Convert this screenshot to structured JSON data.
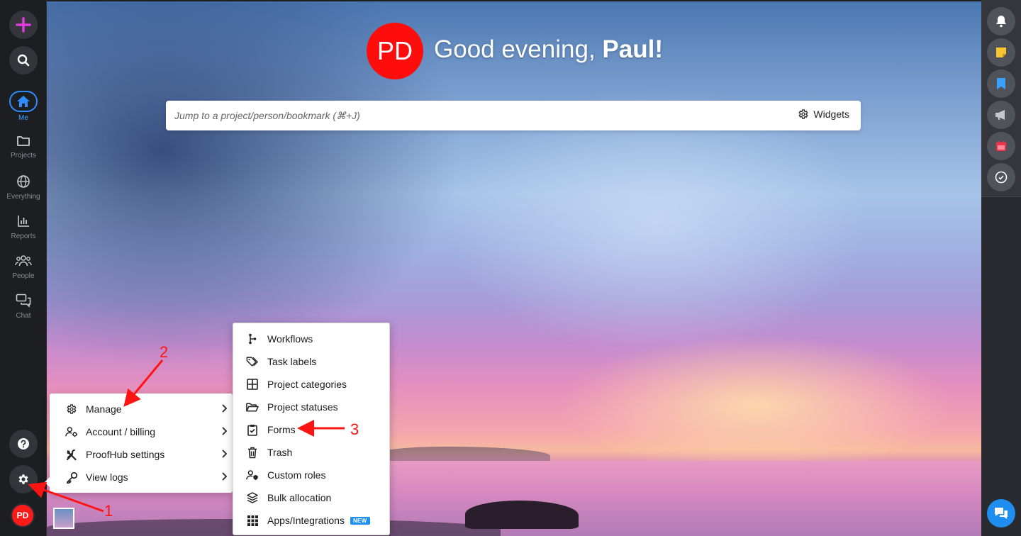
{
  "greeting": {
    "avatar_initials": "PD",
    "prefix": "Good evening, ",
    "name": "Paul!"
  },
  "search": {
    "placeholder": "Jump to a project/person/bookmark (⌘+J)",
    "widgets_label": "Widgets"
  },
  "left_sidebar": {
    "nav": [
      {
        "label": "Me",
        "icon": "home-icon",
        "active": true
      },
      {
        "label": "Projects",
        "icon": "folder-icon"
      },
      {
        "label": "Everything",
        "icon": "globe-icon"
      },
      {
        "label": "Reports",
        "icon": "bar-chart-icon"
      },
      {
        "label": "People",
        "icon": "people-icon"
      },
      {
        "label": "Chat",
        "icon": "chat-icon"
      }
    ],
    "avatar_initials": "PD"
  },
  "settings_menu": {
    "items": [
      {
        "label": "Manage",
        "icon": "gear-icon"
      },
      {
        "label": "Account / billing",
        "icon": "user-gear-icon"
      },
      {
        "label": "ProofHub settings",
        "icon": "tools-icon"
      },
      {
        "label": "View logs",
        "icon": "key-icon"
      }
    ]
  },
  "manage_submenu": {
    "items": [
      {
        "label": "Workflows",
        "icon": "workflow-icon"
      },
      {
        "label": "Task labels",
        "icon": "tags-icon"
      },
      {
        "label": "Project categories",
        "icon": "grid-icon"
      },
      {
        "label": "Project statuses",
        "icon": "folder-open-icon"
      },
      {
        "label": "Forms",
        "icon": "clipboard-check-icon"
      },
      {
        "label": "Trash",
        "icon": "trash-icon"
      },
      {
        "label": "Custom roles",
        "icon": "user-shield-icon"
      },
      {
        "label": "Bulk allocation",
        "icon": "layers-icon"
      },
      {
        "label": "Apps/Integrations",
        "icon": "apps-grid-icon",
        "badge": "NEW"
      }
    ]
  },
  "annotations": [
    "1",
    "2",
    "3"
  ],
  "colors": {
    "accent": "#1f8ef1",
    "avatar_red": "#ff0d0d",
    "annotation_red": "#ff1414",
    "create_plus": "#e03ce0"
  }
}
